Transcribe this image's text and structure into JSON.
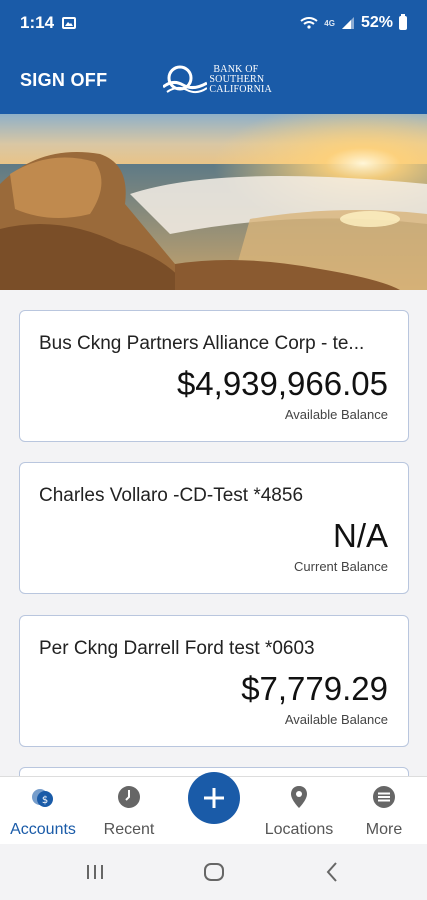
{
  "status_bar": {
    "time": "1:14",
    "network_label": "4G",
    "battery": "52%",
    "icons": [
      "image-icon",
      "wifi-icon",
      "signal-icon",
      "battery-icon"
    ]
  },
  "header": {
    "sign_off": "SIGN OFF",
    "brand_line1": "BANK OF",
    "brand_line2": "SOUTHERN",
    "brand_line3": "CALIFORNIA"
  },
  "accounts": [
    {
      "name": "Bus Ckng Partners Alliance Corp - te...",
      "amount": "$4,939,966.05",
      "label": "Available Balance"
    },
    {
      "name": "Charles Vollaro -CD-Test *4856",
      "amount": "N/A",
      "label": "Current Balance"
    },
    {
      "name": "Per Ckng Darrell Ford test *0603",
      "amount": "$7,779.29",
      "label": "Available Balance"
    }
  ],
  "bottom_nav": {
    "accounts": "Accounts",
    "accounts_badge": "$",
    "recent": "Recent",
    "locations": "Locations",
    "more": "More"
  },
  "colors": {
    "brand_blue": "#1a5ba8",
    "card_border": "#b9c6de",
    "background": "#f3f3f5"
  }
}
